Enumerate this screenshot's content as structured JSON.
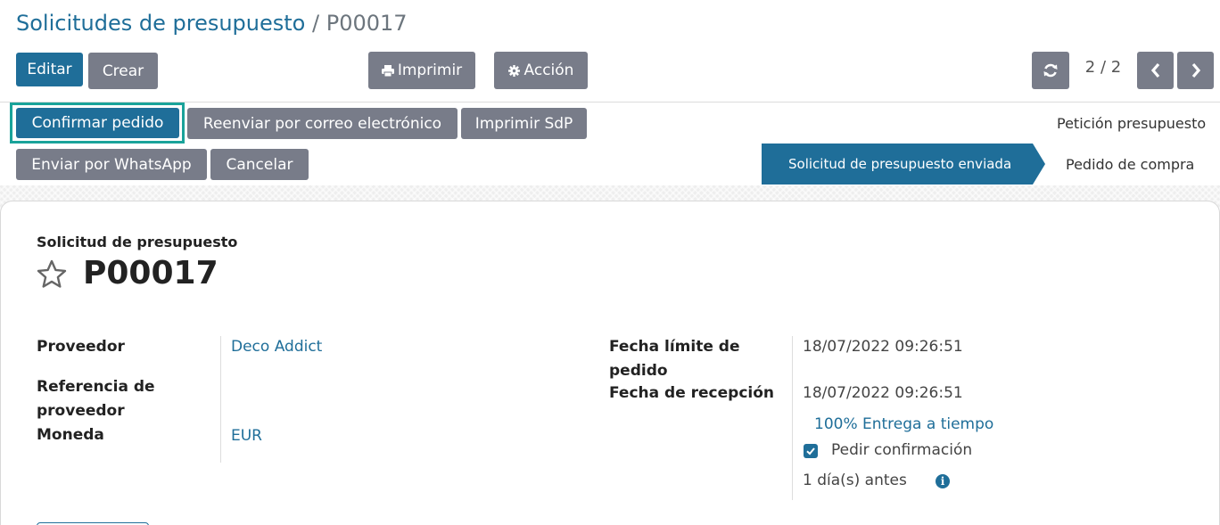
{
  "breadcrumb": {
    "parent": "Solicitudes de presupuesto",
    "separator": "/",
    "current": "P00017"
  },
  "toolbar": {
    "edit": "Editar",
    "create": "Crear",
    "print": "Imprimir",
    "action": "Acción",
    "print_icon": "printer-icon",
    "action_icon": "gear-icon"
  },
  "pager": {
    "value": "2 / 2",
    "refresh_icon": "refresh-icon",
    "prev_icon": "chevron-left-icon",
    "next_icon": "chevron-right-icon"
  },
  "status_buttons": {
    "confirm_order": "Confirmar pedido",
    "resend_email": "Reenviar por correo electrónico",
    "print_rfq": "Imprimir SdP",
    "send_whatsapp": "Enviar por WhatsApp",
    "cancel": "Cancelar"
  },
  "statusbar": {
    "stages": [
      "Petición presupuesto",
      "Solicitud de presupuesto enviada",
      "Pedido de compra"
    ],
    "active_stage": "Solicitud de presupuesto enviada"
  },
  "form": {
    "doc_type": "Solicitud de presupuesto",
    "doc_name": "P00017",
    "favorite_icon": "star-icon",
    "fields": {
      "vendor_label": "Proveedor",
      "vendor_value": "Deco Addict",
      "vendor_ref_label": "Referencia de proveedor",
      "currency_label": "Moneda",
      "currency_value": "EUR",
      "order_deadline_label": "Fecha límite de pedido",
      "order_deadline_value": "18/07/2022 09:26:51",
      "receipt_date_label": "Fecha de recepción",
      "receipt_date_value": "18/07/2022 09:26:51",
      "on_time_delivery": "100% Entrega a tiempo",
      "ask_confirmation_label": "Pedir confirmación",
      "ask_confirmation_checked": true,
      "days_before": "1 día(s) antes",
      "info_icon": "info-icon"
    }
  },
  "colors": {
    "primary": "#1f6e99",
    "secondary": "#787c89",
    "focus": "#1aa39a"
  }
}
